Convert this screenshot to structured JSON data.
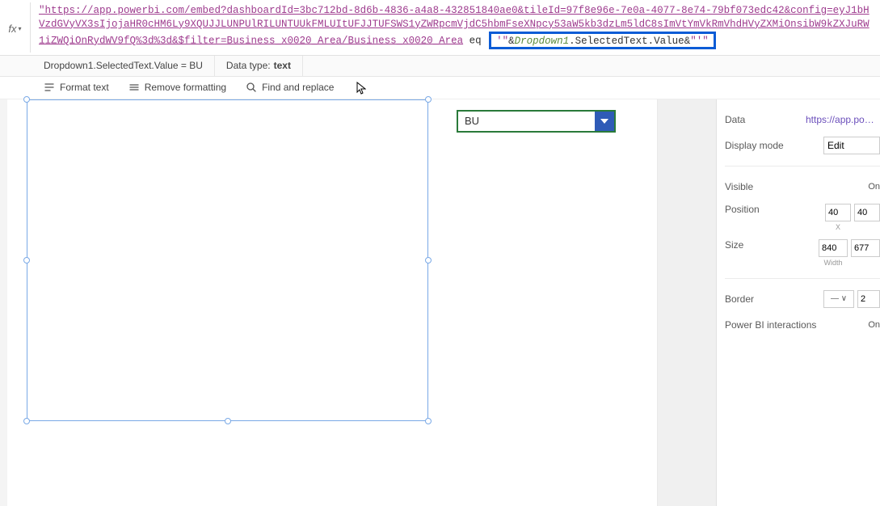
{
  "formula": {
    "fx": "fx",
    "url_part1": "\"https://app.powerbi.com/embed?dashboardId=3bc712bd-8d6b-4836-a4a8-432851840ae0&tileId=97f8e96e-7e0a-4077-8e74-79bf073edc42&config=eyJ1bHVzdGVyVX3sIjojaHR0cHM6Ly9XQUJJLUNPUlRILUNTUUkFMLUItUFJJTUFSWS1yZWRpcmVjdC5hbmFseXNpcy53aW5kb3dzLm5ldC8sImVtYmVkRmVhdHVyZXMiOnsibW9kZXJuRW1iZWQiOnRydWV9fQ%3d%3d&$filter=Business_x0020_Area/Business_x0020_Area",
    "eq": " eq ",
    "quote_open": "'\"",
    "amp": "&",
    "highlighted_var": "Dropdown1",
    "highlighted_rest": ".SelectedText.Value",
    "amp2": "&",
    "quote_close": "\"'\""
  },
  "infoRow": {
    "expression": "Dropdown1.SelectedText.Value  =  BU",
    "datatype_label": "Data type:",
    "datatype_value": "text"
  },
  "toolbar": {
    "format": "Format text",
    "remove": "Remove formatting",
    "find": "Find and replace"
  },
  "dropdown": {
    "selected": "BU"
  },
  "props": {
    "data_label": "Data",
    "data_value": "https://app.powerbi",
    "display_label": "Display mode",
    "display_value": "Edit",
    "visible_label": "Visible",
    "visible_value": "On",
    "position_label": "Position",
    "position_x": "40",
    "position_y": "40",
    "position_x_sub": "X",
    "size_label": "Size",
    "size_w": "840",
    "size_h": "677",
    "size_w_sub": "Width",
    "border_label": "Border",
    "border_style": "— ∨",
    "border_width": "2",
    "pbi_label": "Power BI interactions",
    "pbi_value": "On"
  }
}
